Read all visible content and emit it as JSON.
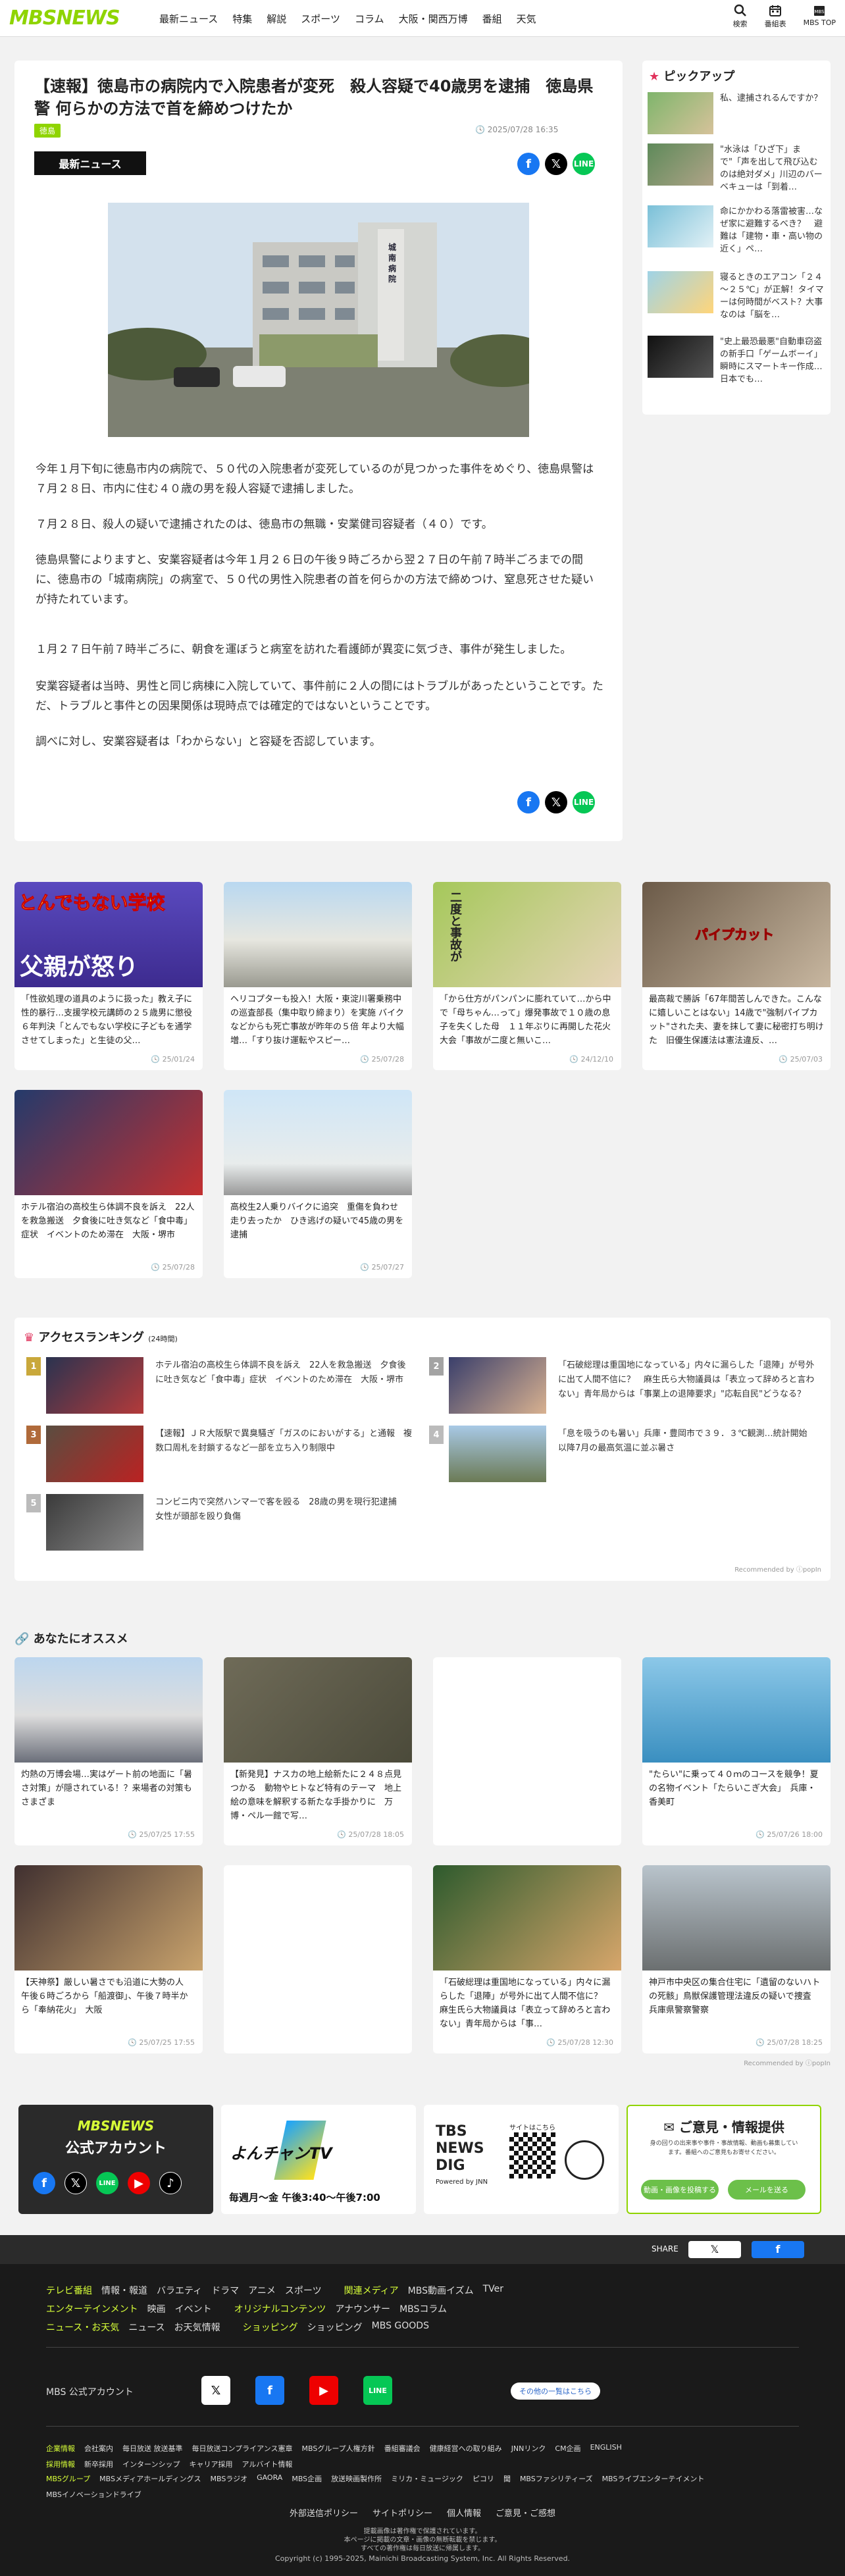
{
  "header": {
    "logo": "MBSNEWS",
    "nav": [
      "最新ニュース",
      "特集",
      "解説",
      "スポーツ",
      "コラム",
      "大阪・関西万博",
      "番組",
      "天気"
    ],
    "tools": [
      {
        "label": "検索",
        "icon": "search-icon"
      },
      {
        "label": "番組表",
        "icon": "calendar-icon"
      },
      {
        "label": "MBS TOP",
        "icon": "mbs-home-icon"
      }
    ]
  },
  "article": {
    "title": "【速報】徳島市の病院内で入院患者が変死　殺人容疑で40歳男を逮捕　徳島県警 何らかの方法で首を締めつけたか",
    "category": "徳島",
    "date": "2025/07/28 16:35",
    "badge": "最新ニュース",
    "paragraphs": [
      "今年１月下旬に徳島市内の病院で、５０代の入院患者が変死しているのが見つかった事件をめぐり、徳島県警は７月２８日、市内に住む４０歳の男を殺人容疑で逮捕しました。",
      "７月２８日、殺人の疑いで逮捕されたのは、徳島市の無職・安業健司容疑者（４０）です。",
      "徳島県警によりますと、安業容疑者は今年１月２６日の午後９時ごろから翌２７日の午前７時半ごろまでの間に、徳島市の「城南病院」の病室で、５０代の男性入院患者の首を何らかの方法で締めつけ、窒息死させた疑いが持たれています。",
      "１月２７日午前７時半ごろに、朝食を運ぼうと病室を訪れた看護師が異変に気づき、事件が発生しました。",
      "安業容疑者は当時、男性と同じ病棟に入院していて、事件前に２人の間にはトラブルがあったということです。ただ、トラブルと事件との因果関係は現時点では確定的ではないということです。",
      "調べに対し、安業容疑者は「わからない」と容疑を否認しています。"
    ],
    "building_sign": "城南病院"
  },
  "pickup": {
    "heading": "ピックアップ",
    "items": [
      "私、逮捕されるんですか？",
      "\"水泳は「ひざ下」まで\"「声を出して飛び込むのは絶対ダメ」川辺のバーベキューは「到着…",
      "命にかかわる落雷被害…なぜ家に避難するべき？　避難は「建物・車・高い物の近く」ペ…",
      "寝るときのエアコン「２４～２５℃」が正解！タイマーは何時間がベスト？大事なのは「脳を…",
      "\"史上最恐最悪\"自動車窃盗の新手口「ゲームボーイ」瞬時にスマートキー作成…日本でも…"
    ]
  },
  "related": [
    {
      "title": "「性欲処理の道具のように扱った」教え子に性的暴行…支援学校元講師の２５歳男に懲役６年判決「とんでもない学校に子どもを通学させてしまった」と生徒の父…",
      "date": "25/01/24",
      "overlay": "とんでもない学校",
      "overlay2": "父親が怒り"
    },
    {
      "title": "ヘリコプターも投入！大阪・東淀川署乗務中の巡査部長（集中取り締まり）を実施 バイクなどからも死亡事故が昨年の５倍 年より大幅増…「すり抜け運転やスピー…",
      "date": "25/07/28",
      "overlay": "",
      "overlay2": ""
    },
    {
      "title": "「から仕方がパンパンに膨れていて…から中で「母ちゃん…って」爆発事故で１０歳の息子を失くした母　１１年ぶりに再開した花火大会「事故が二度と無いこ…",
      "date": "24/12/10",
      "overlay": "二度と事故が",
      "overlay2": ""
    },
    {
      "title": "最高裁で勝訴「67年間苦しんできた。こんなに嬉しいことはない」14歳で\"強制パイプカット\"された夫、妻を抹して妻に秘密打ち明けた　旧優生保護法は憲法違反、…",
      "date": "25/07/03",
      "overlay": "パイプカット",
      "overlay2": ""
    },
    {
      "title": "ホテル宿泊の高校生ら体調不良を訴え　22人を救急搬送　夕食後に吐き気など「食中毒」症状　イベントのため滞在　大阪・堺市",
      "date": "25/07/28",
      "overlay": "",
      "overlay2": ""
    },
    {
      "title": "高校生2人乗りバイクに追突　重傷を負わせ走り去ったか　ひき逃げの疑いで45歳の男を逮捕",
      "date": "25/07/27",
      "overlay": "",
      "overlay2": ""
    }
  ],
  "ranking": {
    "heading": "アクセスランキング",
    "period": "(24時間)",
    "items": [
      {
        "rank": "1",
        "title": "ホテル宿泊の高校生ら体調不良を訴え　22人を救急搬送　夕食後に吐き気など「食中毒」症状　イベントのため滞在　大阪・堺市"
      },
      {
        "rank": "2",
        "title": "「石破総理は重国地になっている」内々に漏らした「退陣」が号外に出て人間不信に？　麻生氏ら大物議員は「表立って辞めろと言わない」青年局からは「事業上の退陣要求」\"応転自民\"どうなる？"
      },
      {
        "rank": "3",
        "title": "【速報】ＪＲ大阪駅で異臭騒ぎ「ガスのにおいがする」と通報　複数口周札を封鎖するなど一部を立ち入り制限中"
      },
      {
        "rank": "4",
        "title": "「息を吸うのも暑い」兵庫・豊岡市で３９．３℃観測…統計開始以降7月の最高気温に並ぶ暑さ"
      },
      {
        "rank": "5",
        "title": "コンビニ内で突然ハンマーで客を殴る　28歳の男を現行犯逮捕　女性が頭部を殴り負傷"
      }
    ],
    "recommended": "Recommended by ⓘpopIn"
  },
  "recommend": {
    "heading": "あなたにオススメ",
    "items": [
      {
        "title": "灼熱の万博会場…実はゲート前の地面に「暑さ対策」が隠されている！？来場者の対策もさまざま",
        "date": "25/07/25 17:55",
        "img": "expo"
      },
      {
        "title": "【新発見】ナスカの地上絵新たに２４８点見つかる　動物やヒトなど特有のテーマ　地上絵の意味を解釈する新たな手掛かりに　万博・ペル一館で写…",
        "date": "25/07/28 18:05",
        "img": "nazca"
      },
      {
        "title": "",
        "date": "",
        "img": "blank"
      },
      {
        "title": "\"たらい\"に乗って４０ｍのコースを競争！夏の名物イベント「たらいこぎ大会」　兵庫・香美町",
        "date": "25/07/26 18:00",
        "img": "tarai"
      },
      {
        "title": "【天神祭】厳しい暑さでも沿道に大勢の人　午後６時ごろから「船渡御」、午後７時半から「奉納花火」　大阪",
        "date": "25/07/25 17:55",
        "img": "tenjin"
      },
      {
        "title": "",
        "date": "",
        "img": "blank"
      },
      {
        "title": "「石破総理は重国地になっている」内々に漏らした「退陣」が号外に出て人間不信に？　麻生氏ら大物議員は「表立って辞めろと言わない」青年局からは「事…",
        "date": "25/07/28 12:30",
        "img": "ishiba"
      },
      {
        "title": "神戸市中央区の集合住宅に「遺留のないハトの死骸」鳥獣保護管理法違反の疑いで捜査　兵庫県警察警察",
        "date": "25/07/28 18:25",
        "img": "kobe"
      }
    ],
    "recommended": "Recommended by ⓘpopIn"
  },
  "banners": {
    "official_title": "MBSNEWS",
    "official_sub": "公式アカウント",
    "yon_title": "よんチャンTV",
    "yon_time": "毎週月～金 午後3:40～午後7:00",
    "tbs_title": "TBS NEWS DIG",
    "tbs_powered": "Powered by JNN",
    "tbs_site": "サイトはこちら",
    "opinion_title": "ご意見・情報提供",
    "opinion_text": "身の回りの出来事や事件・事故情報、動画も募集しています。番組へのご意見もお寄せください。",
    "opinion_btn1": "動画・画像を投稿する",
    "opinion_btn2": "メールを送る"
  },
  "share_bar": {
    "label": "SHARE"
  },
  "footer": {
    "rows": [
      {
        "head": "テレビ番組",
        "items": [
          "情報・報道",
          "バラエティ",
          "ドラマ",
          "アニメ",
          "スポーツ"
        ],
        "head2": "関連メディア",
        "items2": [
          "MBS動画イズム",
          "TVer"
        ]
      },
      {
        "head": "エンターテインメント",
        "items": [
          "映画",
          "イベント"
        ],
        "head2": "オリジナルコンテンツ",
        "items2": [
          "アナウンサー",
          "MBSコラム"
        ]
      },
      {
        "head": "ニュース・お天気",
        "items": [
          "ニュース",
          "お天気情報"
        ],
        "head2": "ショッピング",
        "items2": [
          "ショッピング",
          "MBS GOODS"
        ]
      }
    ],
    "official": "MBS 公式アカウント",
    "more": "その他の一覧はこちら",
    "corp_head": "企業情報",
    "corp_items": [
      "会社案内",
      "毎日放送 放送基準",
      "毎日放送コンプライアンス憲章",
      "MBSグループ人権方針",
      "番組審議会",
      "健康経営への取り組み",
      "JNNリンク",
      "CM企画",
      "ENGLISH"
    ],
    "recruit_head": "採用情報",
    "recruit_items": [
      "新卒採用",
      "インターンシップ",
      "キャリア採用",
      "アルバイト情報"
    ],
    "group_head": "MBSグループ",
    "group_items": [
      "MBSメディアホールディングス",
      "MBSラジオ",
      "GAORA",
      "MBS企画",
      "放送映画製作所",
      "ミリカ・ミュージック",
      "ピコリ",
      "聞",
      "MBSファシリティーズ",
      "MBSライブエンターテイメント",
      "MBSイノベーションドライブ"
    ],
    "bottom_links": [
      "外部送信ポリシー",
      "サイトポリシー",
      "個人情報",
      "ご意見・ご感想"
    ],
    "notice": "提載画像は著作権で保護されています。",
    "notice2": "本ページに掲載の文章・画像の無断転載を禁じます。",
    "notice3": "すべての著作権は毎日放送に帰属します。",
    "copyright": "Copyright (c) 1995-2025, Mainichi Broadcasting System, Inc. All Rights Reserved."
  }
}
